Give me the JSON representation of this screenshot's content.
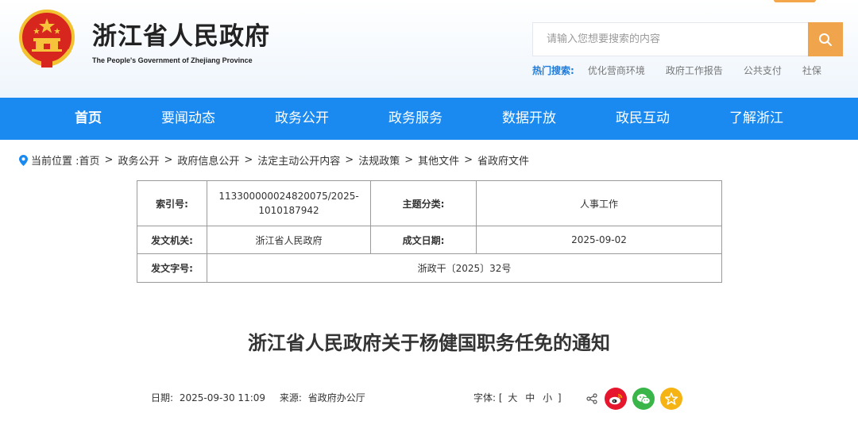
{
  "header": {
    "title": "浙江省人民政府",
    "subtitle": "The People's Government of Zhejiang Province"
  },
  "search": {
    "placeholder": "请输入您想要搜索的内容",
    "hot_label": "热门搜索:",
    "hot_items": [
      "优化营商环境",
      "政府工作报告",
      "公共支付",
      "社保"
    ]
  },
  "nav": {
    "items": [
      "首页",
      "要闻动态",
      "政务公开",
      "政务服务",
      "数据开放",
      "政民互动",
      "了解浙江"
    ],
    "active": "首页"
  },
  "breadcrumb": {
    "prefix": "当前位置 :",
    "items": [
      "首页",
      "政务公开",
      "政府信息公开",
      "法定主动公开内容",
      "法规政策",
      "其他文件",
      "省政府文件"
    ],
    "separator": ">"
  },
  "info": {
    "index_label": "索引号:",
    "index_value": "113300000024820075/2025-1010187942",
    "topic_label": "主题分类:",
    "topic_value": "人事工作",
    "issuer_label": "发文机关:",
    "issuer_value": "浙江省人民政府",
    "date_label": "成文日期:",
    "date_value": "2025-09-02",
    "docno_label": "发文字号:",
    "docno_value": "浙政干〔2025〕32号"
  },
  "document": {
    "title": "浙江省人民政府关于杨健国职务任免的通知"
  },
  "meta": {
    "date_label": "日期:",
    "date_value": "2025-09-30 11:09",
    "source_label": "来源:",
    "source_value": "省政府办公厅",
    "font_label": "字体:",
    "font_open": "[",
    "font_large": "大",
    "font_medium": "中",
    "font_small": "小",
    "font_close": "]"
  },
  "colors": {
    "nav_blue": "#1a8af0",
    "accent_orange": "#f0a44c",
    "hot_label_blue": "#1f7ad9",
    "weibo_red": "#e6162d",
    "wechat_green": "#3ab54a",
    "favorite_yellow": "#f5b414"
  },
  "icons": [
    "national-emblem-icon",
    "search-icon",
    "location-pin-icon",
    "share-icon",
    "weibo-icon",
    "wechat-icon",
    "favorite-icon"
  ]
}
